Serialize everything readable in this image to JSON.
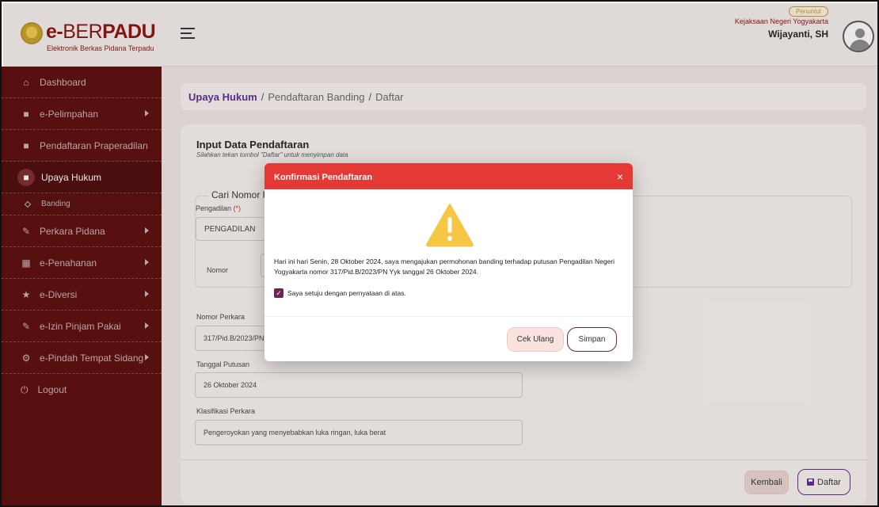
{
  "app": {
    "logo_prefix": "e-",
    "logo_light": "BER",
    "logo_bold": "PADU",
    "logo_subtitle": "Elektronik Berkas Pidana Terpadu"
  },
  "header": {
    "role_badge": "Penuntut",
    "office": "Kejaksaan Negeri Yogyakarta",
    "user_name": "Wijayanti, SH"
  },
  "sidebar": {
    "items": [
      {
        "label": "Dashboard",
        "icon": "home-icon"
      },
      {
        "label": "e-Pelimpahan",
        "icon": "folder-icon"
      },
      {
        "label": "Pendaftaran Praperadilan",
        "icon": "folder-icon"
      },
      {
        "label": "Upaya Hukum",
        "icon": "folder-icon"
      },
      {
        "label": "Banding",
        "icon": "diamond-icon"
      },
      {
        "label": "Perkara Pidana",
        "icon": "edit-icon"
      },
      {
        "label": "e-Penahanan",
        "icon": "grid-icon"
      },
      {
        "label": "e-Diversi",
        "icon": "star-icon"
      },
      {
        "label": "e-Izin Pinjam Pakai",
        "icon": "edit-icon"
      },
      {
        "label": "e-Pindah Tempat Sidang",
        "icon": "gear-icon"
      },
      {
        "label": "Logout",
        "icon": "power-icon"
      }
    ]
  },
  "breadcrumb": {
    "root": "Upaya Hukum",
    "sep": "/",
    "level2": "Pendaftaran Banding",
    "level3": "Daftar"
  },
  "form": {
    "title": "Input Data Pendaftaran",
    "subtitle": "Silahkan tekan tombol \"Daftar\" untuk menyimpan data",
    "search_legend": "Cari Nomor Pe",
    "pengadilan_label": "Pengadilan",
    "required_mark": "(*)",
    "pengadilan_value": "PENGADILAN",
    "nomor_label": "Nomor",
    "nomor_perkara_label": "Nomor Perkara",
    "nomor_perkara_value": "317/Pid.B/2023/PN Y",
    "tanggal_putusan_label": "Tanggal Putusan",
    "tanggal_putusan_value": "26 Oktober 2024",
    "klasifikasi_label": "Klasifikasi Perkara",
    "klasifikasi_value": "Pengeroyokan yang menyebabkan luka ringan, luka berat",
    "btn_kembali": "Kembali",
    "btn_daftar": "Daftar"
  },
  "modal": {
    "title": "Konfirmasi Pendaftaran",
    "close": "×",
    "message": "Hari ini hari Senin, 28 Oktober 2024, saya mengajukan permohonan banding terhadap putusan Pengadilan Negeri Yogyakarta nomor 317/Pid.B/2023/PN Yyk tanggal 26 Oktober 2024.",
    "agree_label": "Saya setuju dengan pernyataan di atas.",
    "agree_checked": true,
    "btn_cek_ulang": "Cek Ulang",
    "btn_simpan": "Simpan"
  },
  "colors": {
    "sidebar_bg": "#5a0a0a",
    "modal_header": "#e53935",
    "accent_purple": "#5b2d90",
    "warning_yellow": "#f6c744"
  }
}
